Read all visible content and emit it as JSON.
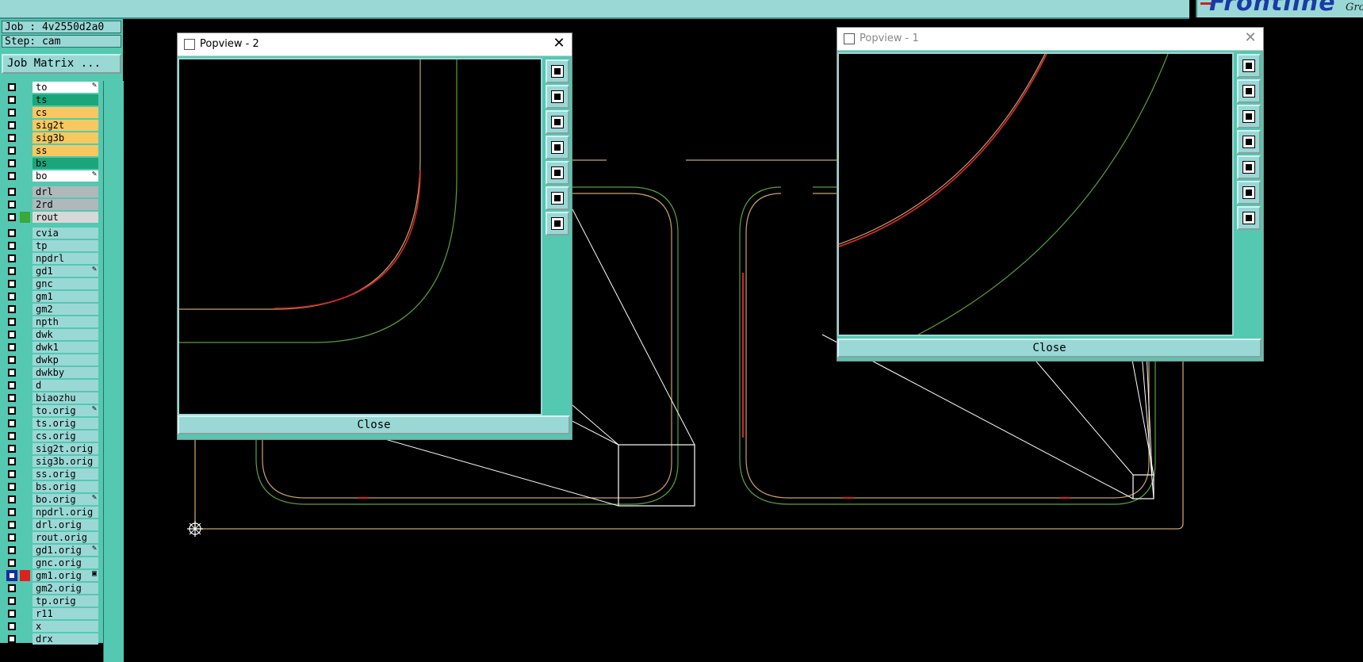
{
  "top": {
    "brand": "Frontline",
    "brand_tail": "Gro"
  },
  "panel": {
    "job": "Job : 4v2550d2a0",
    "step": "Step: cam",
    "job_matrix": "Job Matrix ..."
  },
  "layers": [
    {
      "name": "to",
      "color": "#ffffff",
      "mark": "✎"
    },
    {
      "name": "ts",
      "color": "#1aa67a",
      "mark": ""
    },
    {
      "name": "cs",
      "color": "#f8c860",
      "mark": ""
    },
    {
      "name": "sig2t",
      "color": "#f8c860",
      "mark": ""
    },
    {
      "name": "sig3b",
      "color": "#f8c860",
      "mark": ""
    },
    {
      "name": "ss",
      "color": "#f8c860",
      "mark": ""
    },
    {
      "name": "bs",
      "color": "#1aa67a",
      "mark": ""
    },
    {
      "name": "bo",
      "color": "#ffffff",
      "mark": "✎"
    },
    {
      "name": "drl",
      "color": "#b0b8bc",
      "mark": ""
    },
    {
      "name": "2rd",
      "color": "#b0b8bc",
      "mark": ""
    },
    {
      "name": "rout",
      "color": "#d8d8d8",
      "mark": ""
    },
    {
      "name": "cvia",
      "color": "#9ad8d6",
      "mark": ""
    },
    {
      "name": "tp",
      "color": "#9ad8d6",
      "mark": ""
    },
    {
      "name": "npdrl",
      "color": "#9ad8d6",
      "mark": ""
    },
    {
      "name": "gd1",
      "color": "#9ad8d6",
      "mark": "✎"
    },
    {
      "name": "gnc",
      "color": "#9ad8d6",
      "mark": ""
    },
    {
      "name": "gm1",
      "color": "#9ad8d6",
      "mark": ""
    },
    {
      "name": "gm2",
      "color": "#9ad8d6",
      "mark": ""
    },
    {
      "name": "npth",
      "color": "#9ad8d6",
      "mark": ""
    },
    {
      "name": "dwk",
      "color": "#9ad8d6",
      "mark": ""
    },
    {
      "name": "dwk1",
      "color": "#9ad8d6",
      "mark": ""
    },
    {
      "name": "dwkp",
      "color": "#9ad8d6",
      "mark": ""
    },
    {
      "name": "dwkby",
      "color": "#9ad8d6",
      "mark": ""
    },
    {
      "name": "d",
      "color": "#9ad8d6",
      "mark": ""
    },
    {
      "name": "biaozhu",
      "color": "#9ad8d6",
      "mark": ""
    },
    {
      "name": "to.orig",
      "color": "#9ad8d6",
      "mark": "✎"
    },
    {
      "name": "ts.orig",
      "color": "#9ad8d6",
      "mark": ""
    },
    {
      "name": "cs.orig",
      "color": "#9ad8d6",
      "mark": ""
    },
    {
      "name": "sig2t.orig",
      "color": "#9ad8d6",
      "mark": ""
    },
    {
      "name": "sig3b.orig",
      "color": "#9ad8d6",
      "mark": ""
    },
    {
      "name": "ss.orig",
      "color": "#9ad8d6",
      "mark": ""
    },
    {
      "name": "bs.orig",
      "color": "#9ad8d6",
      "mark": ""
    },
    {
      "name": "bo.orig",
      "color": "#9ad8d6",
      "mark": "✎"
    },
    {
      "name": "npdrl.orig",
      "color": "#9ad8d6",
      "mark": ""
    },
    {
      "name": "drl.orig",
      "color": "#9ad8d6",
      "mark": ""
    },
    {
      "name": "rout.orig",
      "color": "#9ad8d6",
      "mark": ""
    },
    {
      "name": "gd1.orig",
      "color": "#9ad8d6",
      "mark": "✎"
    },
    {
      "name": "gnc.orig",
      "color": "#9ad8d6",
      "mark": ""
    },
    {
      "name": "gm1.orig",
      "color": "#9ad8d6",
      "mark": "▣"
    },
    {
      "name": "gm2.orig",
      "color": "#9ad8d6",
      "mark": ""
    },
    {
      "name": "tp.orig",
      "color": "#9ad8d6",
      "mark": ""
    },
    {
      "name": "r11",
      "color": "#9ad8d6",
      "mark": ""
    },
    {
      "name": "x",
      "color": "#9ad8d6",
      "mark": ""
    },
    {
      "name": "drx",
      "color": "#9ad8d6",
      "mark": ""
    }
  ],
  "popup2": {
    "title": "Popview - 2",
    "close_label": "Close"
  },
  "popup1": {
    "title": "Popview - 1",
    "close_label": "Close"
  },
  "tool_icons": [
    "zoom-popup-icon",
    "move-up-icon",
    "move-down-icon",
    "move-left-icon",
    "move-right-icon",
    "zoom-fit-icon",
    "zoom-center-icon"
  ],
  "colors": {
    "panel": "#54c8b0",
    "button": "#9ad8d6",
    "outline": "#c8a46a",
    "route": "#5aa03c",
    "trace": "#d02828"
  }
}
